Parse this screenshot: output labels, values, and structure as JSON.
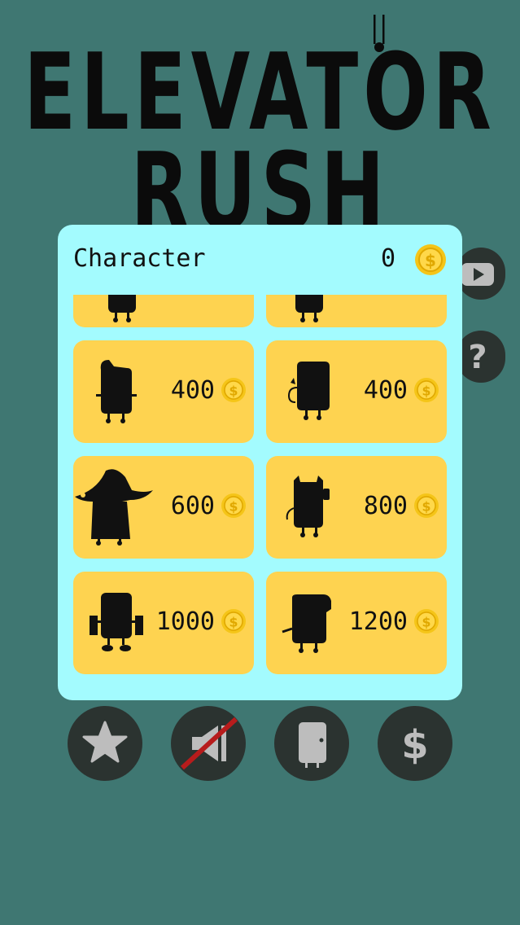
{
  "game": {
    "title_line1": "ELEVATOR",
    "title_line2": "RUSH"
  },
  "panel": {
    "title": "Character",
    "coins": "0"
  },
  "characters": [
    {
      "price": ""
    },
    {
      "price": ""
    },
    {
      "price": "400"
    },
    {
      "price": "400"
    },
    {
      "price": "600"
    },
    {
      "price": "800"
    },
    {
      "price": "1000"
    },
    {
      "price": "1200"
    }
  ],
  "side_buttons": [
    {
      "icon": "youtube-icon"
    },
    {
      "icon": "help-icon",
      "glyph": "?"
    }
  ],
  "bottom_buttons": [
    {
      "icon": "star-icon"
    },
    {
      "icon": "sound-muted-icon"
    },
    {
      "icon": "character-door-icon"
    },
    {
      "icon": "dollar-icon",
      "glyph": "$"
    }
  ],
  "colors": {
    "background": "#3f7772",
    "panel": "#a3fbfe",
    "card": "#fed350",
    "coin": "#f5c518",
    "button": "#2b3330",
    "icon": "#bdbdbd",
    "mute_slash": "#b71c1c"
  }
}
